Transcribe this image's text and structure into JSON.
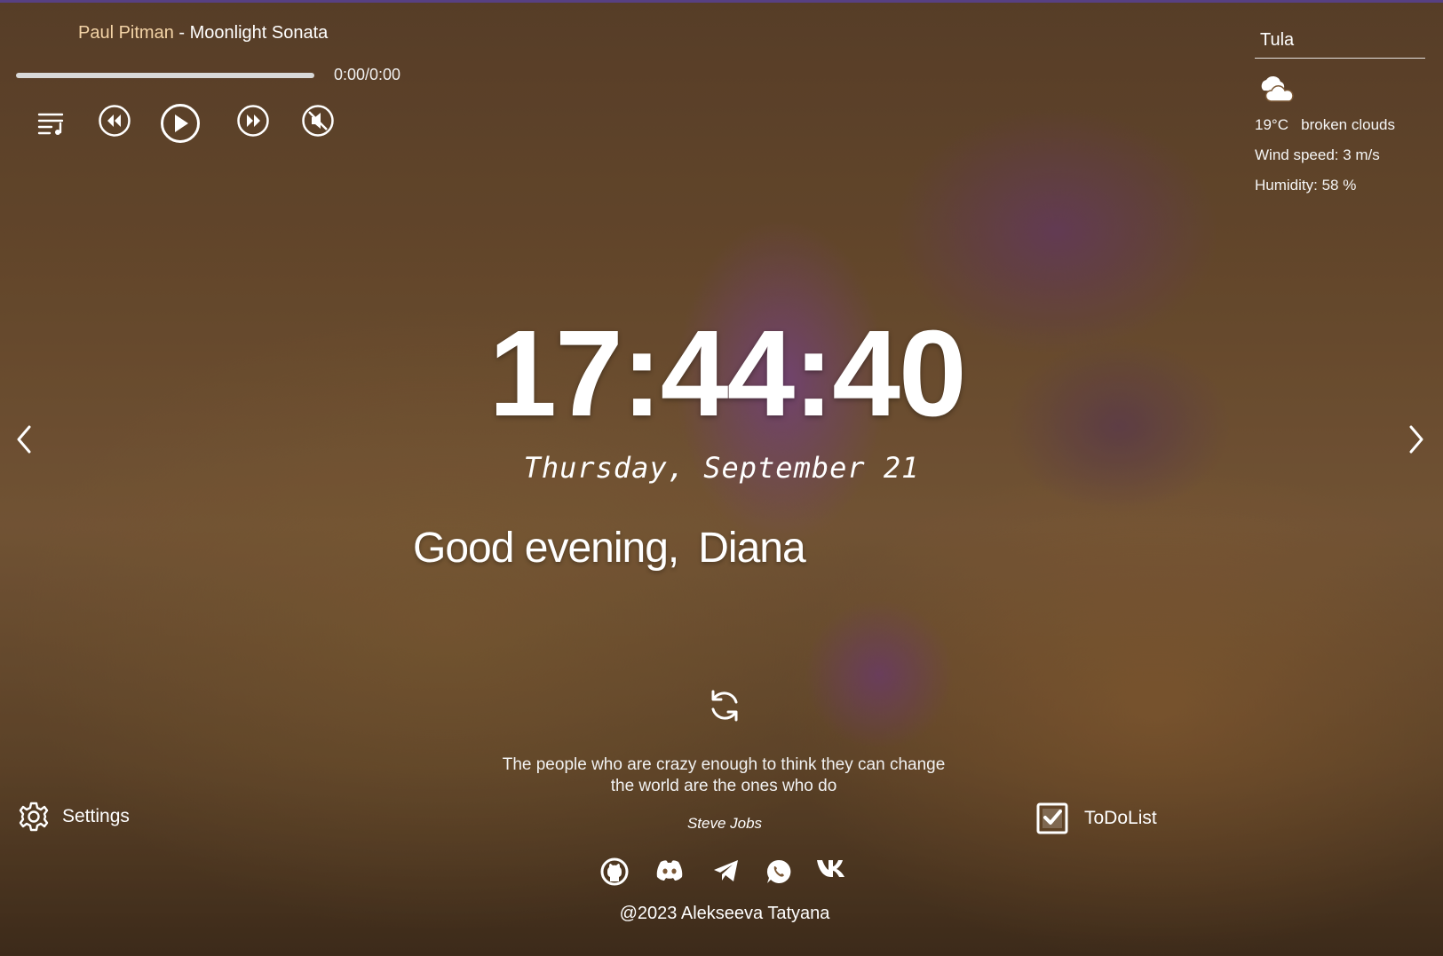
{
  "player": {
    "artist": "Paul Pitman",
    "separator": " - ",
    "title": "Moonlight Sonata",
    "time": "0:00/0:00",
    "progress_fraction": 0,
    "controls": [
      "playlist-icon",
      "previous-icon",
      "play-icon",
      "next-icon",
      "mute-icon"
    ]
  },
  "weather": {
    "city": "Tula",
    "icon": "broken-clouds-icon",
    "temp_desc": "19°C   broken clouds",
    "wind": "Wind speed: 3 m/s",
    "humidity": "Humidity: 58 %"
  },
  "clock": {
    "time": "17:44:40"
  },
  "date": {
    "text": "Thursday, September 21"
  },
  "greeting": {
    "text": "Good evening,",
    "name": "Diana"
  },
  "quote": {
    "text": "The people who are crazy enough to think they can change the world are the ones who do",
    "author": "Steve Jobs"
  },
  "settings": {
    "label": "Settings"
  },
  "todo": {
    "label": "ToDoList"
  },
  "footer": {
    "social": [
      "github-icon",
      "discord-icon",
      "telegram-icon",
      "whatsapp-icon",
      "vk-icon"
    ],
    "copyright": "@2023 Alekseeva Tatyana"
  },
  "colors": {
    "accent_artist": "#f3d3a6",
    "top_border": "#6b4fa0"
  }
}
